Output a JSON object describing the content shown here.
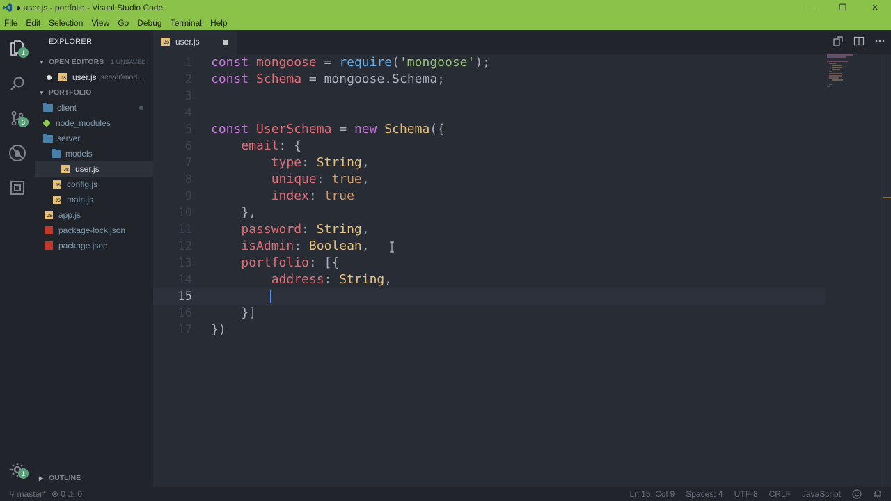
{
  "window": {
    "title": "● user.js - portfolio - Visual Studio Code",
    "controls": {
      "minimize": "—",
      "maximize": "❐",
      "close": "✕"
    }
  },
  "menu": [
    "File",
    "Edit",
    "Selection",
    "View",
    "Go",
    "Debug",
    "Terminal",
    "Help"
  ],
  "activity_bar": {
    "items": [
      "explorer-icon",
      "search-icon",
      "source-control-icon",
      "debug-icon",
      "extensions-icon"
    ],
    "explorer_badge": "1",
    "scm_badge": "3",
    "manage_badge": "1"
  },
  "sidebar": {
    "title": "EXPLORER",
    "open_editors": {
      "label": "OPEN EDITORS",
      "unsaved": "1 UNSAVED",
      "items": [
        {
          "name": "user.js",
          "path": "server\\mod..."
        }
      ]
    },
    "folder": {
      "label": "PORTFOLIO",
      "items": [
        {
          "name": "client",
          "type": "folder",
          "depth": 0
        },
        {
          "name": "node_modules",
          "type": "node",
          "depth": 0
        },
        {
          "name": "server",
          "type": "folder",
          "depth": 0
        },
        {
          "name": "models",
          "type": "folder",
          "depth": 1
        },
        {
          "name": "user.js",
          "type": "js",
          "depth": 2,
          "selected": true
        },
        {
          "name": "config.js",
          "type": "js",
          "depth": 1
        },
        {
          "name": "main.js",
          "type": "js",
          "depth": 1
        },
        {
          "name": "app.js",
          "type": "js",
          "depth": 0
        },
        {
          "name": "package-lock.json",
          "type": "json",
          "depth": 0
        },
        {
          "name": "package.json",
          "type": "json",
          "depth": 0
        }
      ]
    },
    "outline": "OUTLINE"
  },
  "tab": {
    "label": "user.js",
    "modified": true
  },
  "editor": {
    "lines": [
      "const mongoose = require('mongoose');",
      "const Schema = mongoose.Schema;",
      "",
      "",
      "const UserSchema = new Schema({",
      "    email: {",
      "        type: String,",
      "        unique: true,",
      "        index: true",
      "    },",
      "    password: String,",
      "    isAdmin: Boolean,",
      "    portfolio: [{",
      "        address: String,",
      "        ",
      "    }]",
      "})"
    ],
    "current_line": 15
  },
  "status_bar": {
    "branch": "master*",
    "errors": "0",
    "warnings": "0",
    "position": "Ln 15, Col 9",
    "spaces": "Spaces: 4",
    "encoding": "UTF-8",
    "eol": "CRLF",
    "language": "JavaScript"
  }
}
